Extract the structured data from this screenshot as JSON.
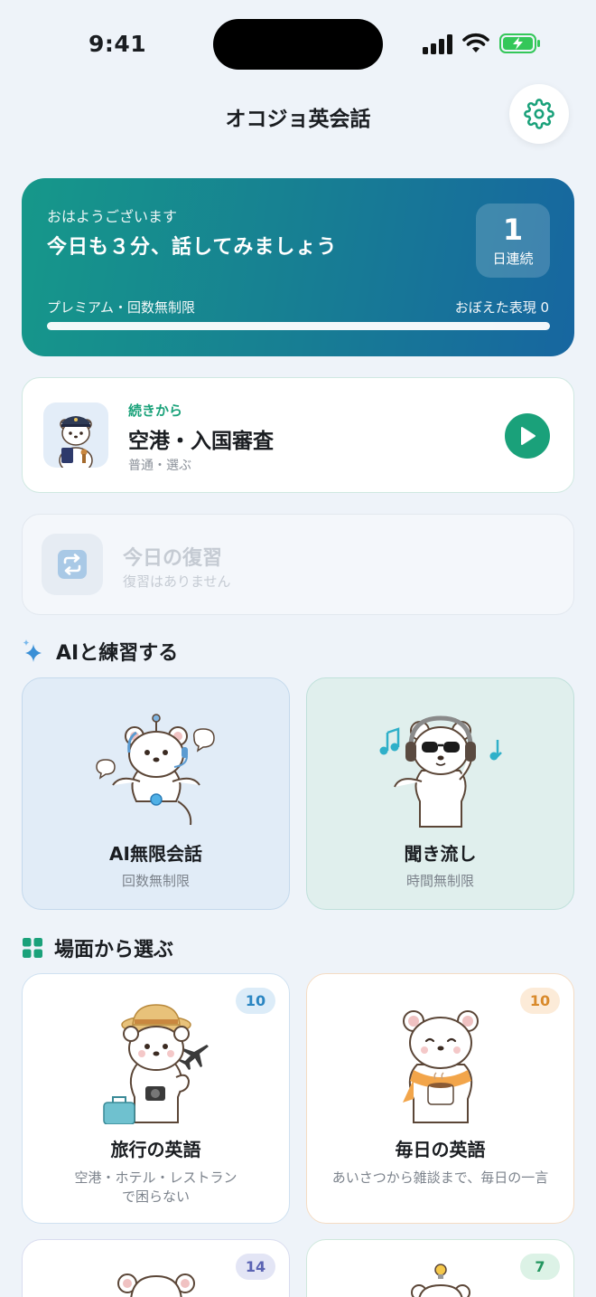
{
  "status_bar": {
    "time": "9:41"
  },
  "header": {
    "title": "オコジョ英会話"
  },
  "hero": {
    "greeting": "おはようございます",
    "headline": "今日も３分、話してみましょう",
    "streak_number": "1",
    "streak_label": "日連続",
    "plan": "プレミアム・回数無制限",
    "phrases": "おぼえた表現 0"
  },
  "continue_card": {
    "kicker": "続きから",
    "title": "空港・入国審査",
    "subtitle": "普通・選ぶ"
  },
  "review_card": {
    "title": "今日の復習",
    "subtitle": "復習はありません"
  },
  "sections": {
    "ai_title": "AIと練習する",
    "scenes_title": "場面から選ぶ"
  },
  "ai_tiles": [
    {
      "label": "AI無限会話",
      "sub": "回数無制限"
    },
    {
      "label": "聞き流し",
      "sub": "時間無制限"
    }
  ],
  "scene_tiles": [
    {
      "label": "旅行の英語",
      "sub1": "空港・ホテル・レストラン",
      "sub2": "で困らない",
      "count": "10",
      "badge_color": "#2b86c2",
      "badge_bg": "#dcecf8"
    },
    {
      "label": "毎日の英語",
      "sub1": "あいさつから雑談まで、毎日の一言",
      "count": "10",
      "badge_color": "#d98a2b",
      "badge_bg": "#fcebd8"
    },
    {
      "label": "",
      "count": "14",
      "badge_color": "#5a63b3",
      "badge_bg": "#e3e5f5"
    },
    {
      "label": "",
      "count": "7",
      "badge_color": "#22965f",
      "badge_bg": "#dcf2e6"
    }
  ],
  "icons": {
    "settings": "gear-icon",
    "play": "play-icon",
    "review": "repeat-icon",
    "ai_section": "sparkle-icon",
    "scenes_section": "grid-icon"
  },
  "colors": {
    "accent": "#1aa17a",
    "hero_gradient_start": "#16988a",
    "hero_gradient_end": "#1766a0"
  }
}
